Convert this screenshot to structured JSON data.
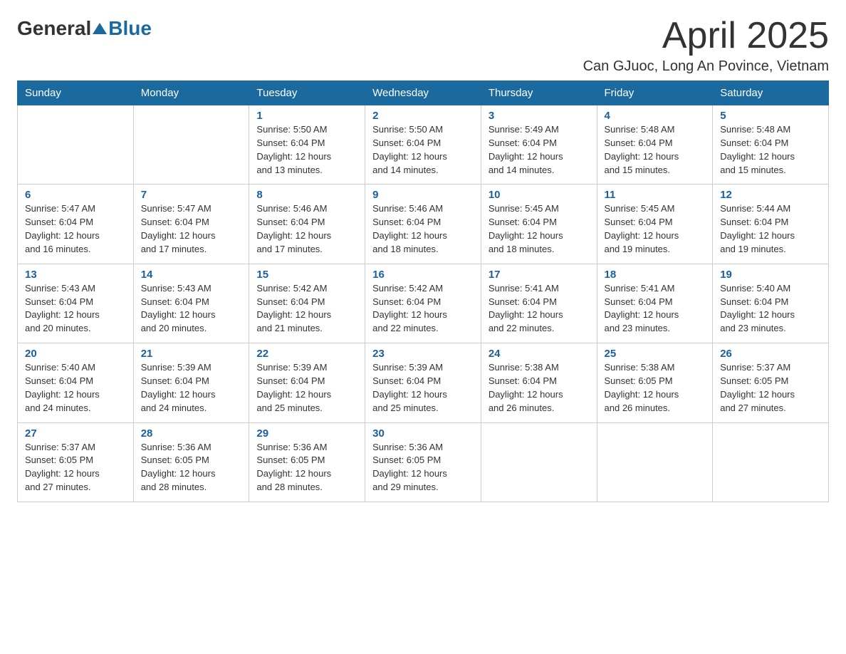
{
  "logo": {
    "general": "General",
    "blue": "Blue"
  },
  "title": "April 2025",
  "location": "Can GJuoc, Long An Povince, Vietnam",
  "days_of_week": [
    "Sunday",
    "Monday",
    "Tuesday",
    "Wednesday",
    "Thursday",
    "Friday",
    "Saturday"
  ],
  "weeks": [
    [
      {
        "day": "",
        "info": ""
      },
      {
        "day": "",
        "info": ""
      },
      {
        "day": "1",
        "info": "Sunrise: 5:50 AM\nSunset: 6:04 PM\nDaylight: 12 hours\nand 13 minutes."
      },
      {
        "day": "2",
        "info": "Sunrise: 5:50 AM\nSunset: 6:04 PM\nDaylight: 12 hours\nand 14 minutes."
      },
      {
        "day": "3",
        "info": "Sunrise: 5:49 AM\nSunset: 6:04 PM\nDaylight: 12 hours\nand 14 minutes."
      },
      {
        "day": "4",
        "info": "Sunrise: 5:48 AM\nSunset: 6:04 PM\nDaylight: 12 hours\nand 15 minutes."
      },
      {
        "day": "5",
        "info": "Sunrise: 5:48 AM\nSunset: 6:04 PM\nDaylight: 12 hours\nand 15 minutes."
      }
    ],
    [
      {
        "day": "6",
        "info": "Sunrise: 5:47 AM\nSunset: 6:04 PM\nDaylight: 12 hours\nand 16 minutes."
      },
      {
        "day": "7",
        "info": "Sunrise: 5:47 AM\nSunset: 6:04 PM\nDaylight: 12 hours\nand 17 minutes."
      },
      {
        "day": "8",
        "info": "Sunrise: 5:46 AM\nSunset: 6:04 PM\nDaylight: 12 hours\nand 17 minutes."
      },
      {
        "day": "9",
        "info": "Sunrise: 5:46 AM\nSunset: 6:04 PM\nDaylight: 12 hours\nand 18 minutes."
      },
      {
        "day": "10",
        "info": "Sunrise: 5:45 AM\nSunset: 6:04 PM\nDaylight: 12 hours\nand 18 minutes."
      },
      {
        "day": "11",
        "info": "Sunrise: 5:45 AM\nSunset: 6:04 PM\nDaylight: 12 hours\nand 19 minutes."
      },
      {
        "day": "12",
        "info": "Sunrise: 5:44 AM\nSunset: 6:04 PM\nDaylight: 12 hours\nand 19 minutes."
      }
    ],
    [
      {
        "day": "13",
        "info": "Sunrise: 5:43 AM\nSunset: 6:04 PM\nDaylight: 12 hours\nand 20 minutes."
      },
      {
        "day": "14",
        "info": "Sunrise: 5:43 AM\nSunset: 6:04 PM\nDaylight: 12 hours\nand 20 minutes."
      },
      {
        "day": "15",
        "info": "Sunrise: 5:42 AM\nSunset: 6:04 PM\nDaylight: 12 hours\nand 21 minutes."
      },
      {
        "day": "16",
        "info": "Sunrise: 5:42 AM\nSunset: 6:04 PM\nDaylight: 12 hours\nand 22 minutes."
      },
      {
        "day": "17",
        "info": "Sunrise: 5:41 AM\nSunset: 6:04 PM\nDaylight: 12 hours\nand 22 minutes."
      },
      {
        "day": "18",
        "info": "Sunrise: 5:41 AM\nSunset: 6:04 PM\nDaylight: 12 hours\nand 23 minutes."
      },
      {
        "day": "19",
        "info": "Sunrise: 5:40 AM\nSunset: 6:04 PM\nDaylight: 12 hours\nand 23 minutes."
      }
    ],
    [
      {
        "day": "20",
        "info": "Sunrise: 5:40 AM\nSunset: 6:04 PM\nDaylight: 12 hours\nand 24 minutes."
      },
      {
        "day": "21",
        "info": "Sunrise: 5:39 AM\nSunset: 6:04 PM\nDaylight: 12 hours\nand 24 minutes."
      },
      {
        "day": "22",
        "info": "Sunrise: 5:39 AM\nSunset: 6:04 PM\nDaylight: 12 hours\nand 25 minutes."
      },
      {
        "day": "23",
        "info": "Sunrise: 5:39 AM\nSunset: 6:04 PM\nDaylight: 12 hours\nand 25 minutes."
      },
      {
        "day": "24",
        "info": "Sunrise: 5:38 AM\nSunset: 6:04 PM\nDaylight: 12 hours\nand 26 minutes."
      },
      {
        "day": "25",
        "info": "Sunrise: 5:38 AM\nSunset: 6:05 PM\nDaylight: 12 hours\nand 26 minutes."
      },
      {
        "day": "26",
        "info": "Sunrise: 5:37 AM\nSunset: 6:05 PM\nDaylight: 12 hours\nand 27 minutes."
      }
    ],
    [
      {
        "day": "27",
        "info": "Sunrise: 5:37 AM\nSunset: 6:05 PM\nDaylight: 12 hours\nand 27 minutes."
      },
      {
        "day": "28",
        "info": "Sunrise: 5:36 AM\nSunset: 6:05 PM\nDaylight: 12 hours\nand 28 minutes."
      },
      {
        "day": "29",
        "info": "Sunrise: 5:36 AM\nSunset: 6:05 PM\nDaylight: 12 hours\nand 28 minutes."
      },
      {
        "day": "30",
        "info": "Sunrise: 5:36 AM\nSunset: 6:05 PM\nDaylight: 12 hours\nand 29 minutes."
      },
      {
        "day": "",
        "info": ""
      },
      {
        "day": "",
        "info": ""
      },
      {
        "day": "",
        "info": ""
      }
    ]
  ]
}
